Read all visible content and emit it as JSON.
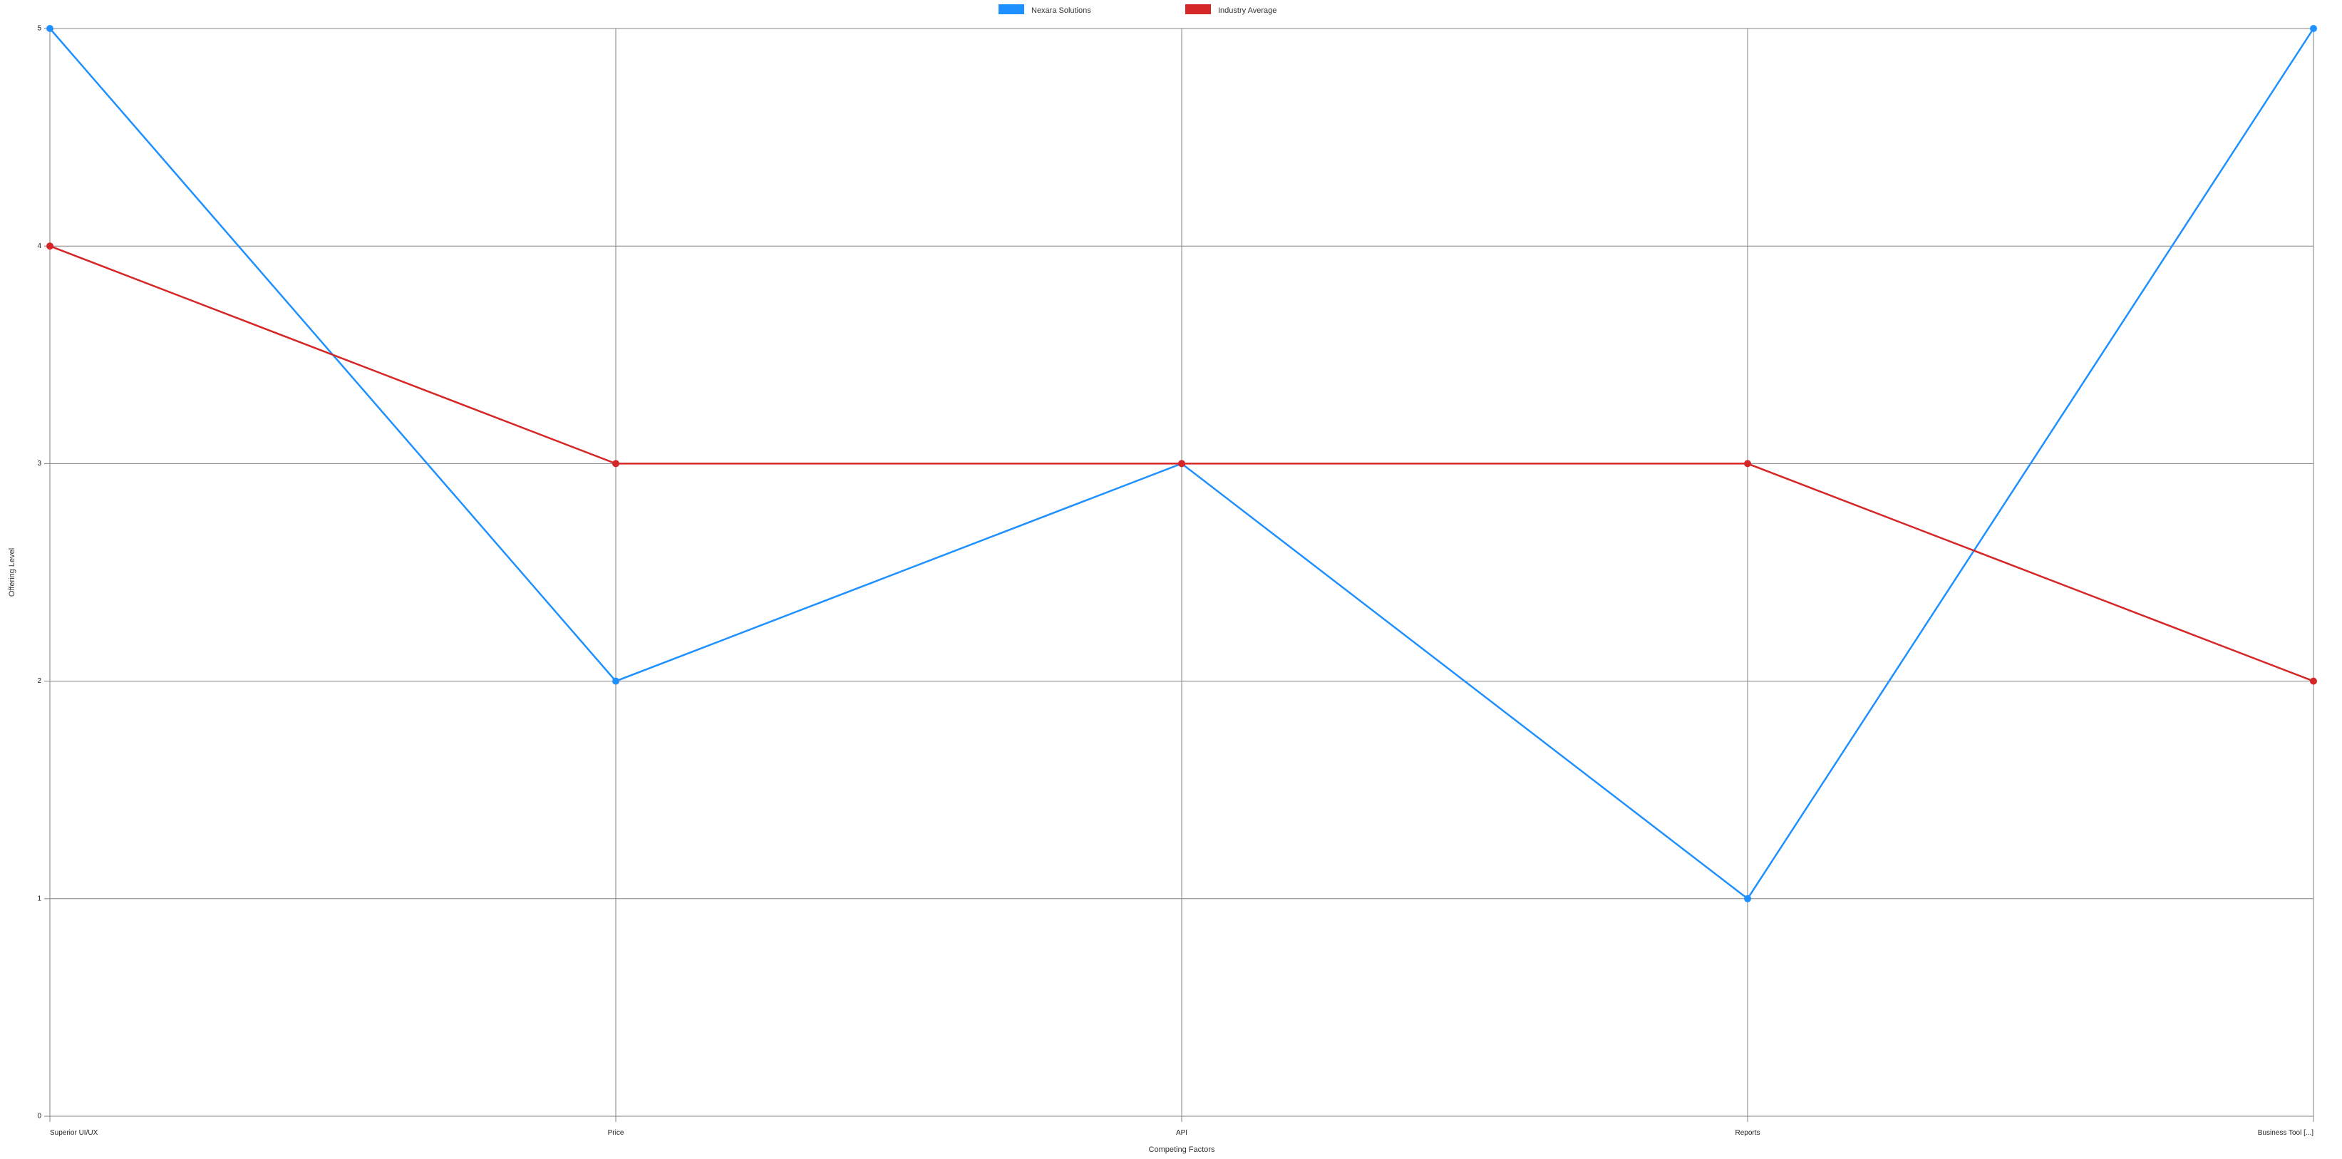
{
  "chart_data": {
    "type": "line",
    "categories": [
      "Superior UI/UX",
      "Price",
      "API",
      "Reports",
      "Business Tool [...]"
    ],
    "series": [
      {
        "name": "Nexara Solutions",
        "color": "#1E90FF",
        "values": [
          5,
          2,
          3,
          1,
          5
        ]
      },
      {
        "name": "Industry Average",
        "color": "#D62728",
        "values": [
          4,
          3,
          3,
          3,
          2
        ]
      }
    ],
    "xlabel": "Competing Factors",
    "ylabel": "Offering Level",
    "ylim": [
      0,
      5
    ],
    "yticks": [
      0,
      1,
      2,
      3,
      4,
      5
    ],
    "grid": true,
    "legend_position": "top-center"
  }
}
